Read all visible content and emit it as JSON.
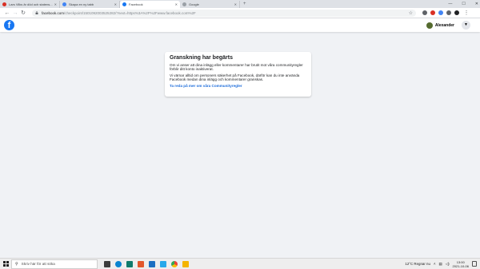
{
  "browser": {
    "tabs": [
      {
        "label": "Lars Vilks är död och statens...",
        "color": "#d93025",
        "active": false
      },
      {
        "label": "Skapa en ny tabb",
        "color": "#4285f4",
        "active": false
      },
      {
        "label": "Facebook",
        "color": "#1877f2",
        "active": true
      },
      {
        "label": "Google",
        "color": "#9aa0a6",
        "active": false
      }
    ],
    "new_tab": "+",
    "window_controls": [
      "—",
      "☐",
      "✕"
    ],
    "url_host": "facebook.com",
    "url_path": "/checkpoint/1501092003525282/?next=https%3A%2F%2Fwww.facebook.com%2F",
    "extension_colors": [
      "#5f6368",
      "#d93025",
      "#4285f4",
      "#5f6368",
      "#202124"
    ]
  },
  "fb": {
    "logo": "f",
    "user_name": "Alexander",
    "menu_icon": "▼"
  },
  "review": {
    "title": "Granskning har begärts",
    "paragraph1": "Om vi anser att dina inlägg eller kommentarer har brutit mot våra communityregler förblir ditt konto inaktiverat.",
    "paragraph2": "Vi värnar alltid om personers säkerhet på Facebook, därför kan du inte använda Facebook medan dina inlägg och kommentarer granskas.",
    "link": "Ta reda på mer om våra Communityregler"
  },
  "taskbar": {
    "search_placeholder": "Skriv här för att söka",
    "pinned_icon_colors": [
      "#3c3c3c",
      "#0a84d0",
      "#0f7b6c",
      "#e2572c",
      "#1c6fc1",
      "#28a8ea",
      "#2ea043",
      "#f4b400"
    ],
    "weather": "12°C  Regnar nu",
    "time": "13:00",
    "date": "2021-10-06"
  }
}
